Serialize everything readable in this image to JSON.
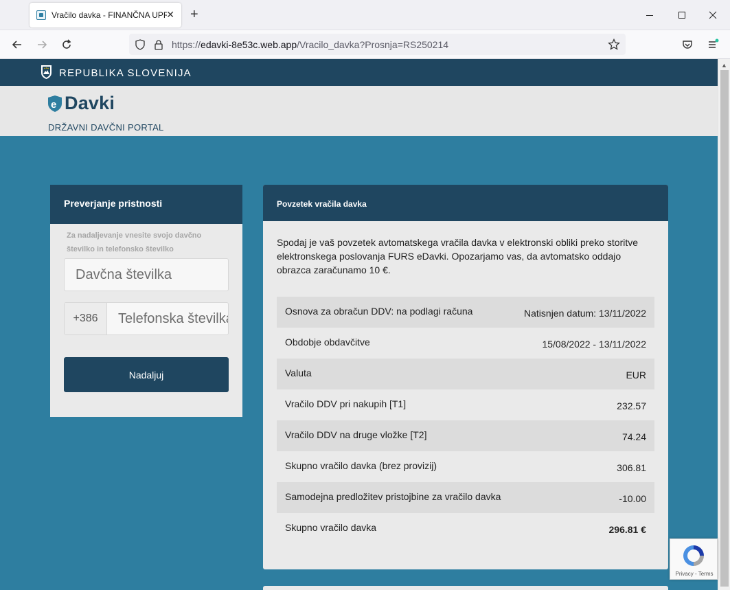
{
  "browser": {
    "tab_title": "Vračilo davka - FINANČNA UPRAVA",
    "tab_close": "✕",
    "new_tab": "+",
    "url_prefix": "https://",
    "url_host": "edavki-8e53c.web.app",
    "url_path": "/Vracilo_davka?Prosnja=RS250214"
  },
  "header": {
    "gov_title": "REPUBLIKA SLOVENIJA",
    "logo_text": "Davki",
    "portal_title": "DRŽAVNI DAVČNI PORTAL"
  },
  "auth": {
    "title": "Preverjanje pristnosti",
    "hint": "Za nadaljevanje vnesite svojo davčno številko in telefonsko številko",
    "tax_placeholder": "Davčna številka",
    "phone_prefix": "+386",
    "phone_placeholder": "Telefonska številka",
    "submit_label": "Nadaljuj"
  },
  "summary": {
    "title": "Povzetek vračila davka",
    "intro": "Spodaj je vaš povzetek avtomatskega vračila davka v elektronski obliki preko storitve elektronskega poslovanja FURS eDavki. Opozarjamo vas, da avtomatsko oddajo obrazca zaračunamo 10 €.",
    "rows": [
      {
        "label": "Osnova za obračun DDV: na podlagi računa",
        "value": "Natisnjen datum: 13/11/2022"
      },
      {
        "label": "Obdobje obdavčitve",
        "value": "15/08/2022 - 13/11/2022"
      },
      {
        "label": "Valuta",
        "value": "EUR"
      },
      {
        "label": "Vračilo DDV pri nakupih [T1]",
        "value": "232.57"
      },
      {
        "label": "Vračilo DDV na druge vložke [T2]",
        "value": "74.24"
      },
      {
        "label": "Skupno vračilo davka (brez provizij)",
        "value": "306.81"
      },
      {
        "label": "Samodejna predložitev pristojbine za vračilo davka",
        "value": "-10.00"
      },
      {
        "label": "Skupno vračilo davka",
        "value": "296.81 €"
      }
    ]
  },
  "recaptcha": {
    "links": "Privacy - Terms"
  },
  "colors": {
    "page_bg": "#2e7ea0",
    "header_dark": "#1f4660",
    "card_bg": "#eaeaea"
  }
}
